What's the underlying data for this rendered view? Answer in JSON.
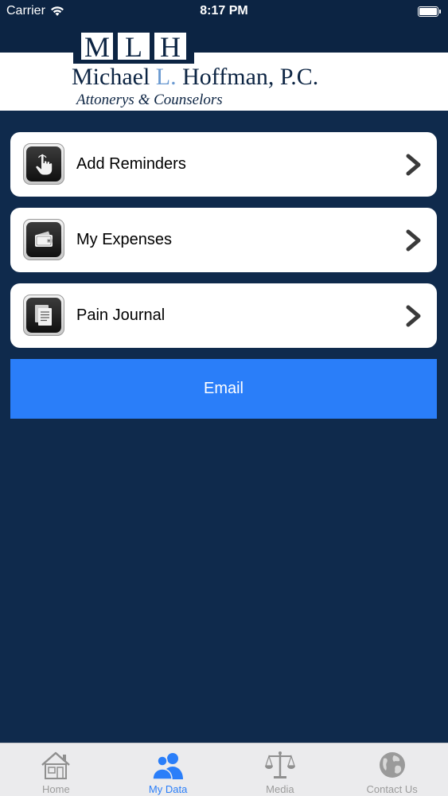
{
  "status_bar": {
    "carrier": "Carrier",
    "time": "8:17 PM",
    "battery_level": 1.0
  },
  "logo": {
    "letters": [
      "M",
      "L",
      "H"
    ],
    "firm_name_first": "Michael",
    "firm_name_middle": "L.",
    "firm_name_last": "Hoffman, P.C.",
    "tagline": "Attonerys & Counselors"
  },
  "menu": {
    "items": [
      {
        "label": "Add Reminders",
        "icon": "touch-hand-icon"
      },
      {
        "label": "My Expenses",
        "icon": "wallet-icon"
      },
      {
        "label": "Pain Journal",
        "icon": "document-icon"
      }
    ]
  },
  "email_button": {
    "label": "Email"
  },
  "tabs": {
    "items": [
      {
        "label": "Home",
        "icon": "house-icon",
        "active": false
      },
      {
        "label": "My Data",
        "icon": "user-group-icon",
        "active": true
      },
      {
        "label": "Media",
        "icon": "scales-icon",
        "active": false
      },
      {
        "label": "Contact Us",
        "icon": "globe-icon",
        "active": false
      }
    ]
  },
  "colors": {
    "background": "#0f2a4c",
    "email_button": "#2a7ef9",
    "active_tab": "#2a7ef9",
    "inactive_tab": "#9b9b9b"
  }
}
